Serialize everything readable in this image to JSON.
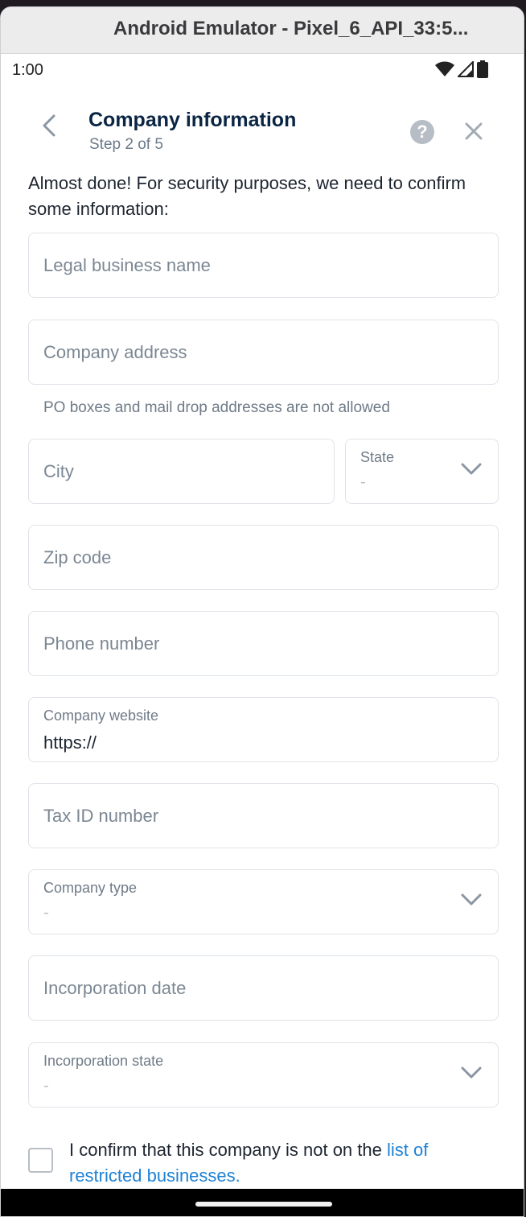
{
  "window": {
    "title": "Android Emulator - Pixel_6_API_33:5..."
  },
  "status_bar": {
    "time": "1:00",
    "icons": [
      "wifi-icon",
      "signal-icon",
      "battery-icon"
    ]
  },
  "header": {
    "title": "Company information",
    "step": "Step 2 of 5",
    "icons": {
      "back": "chevron-left-icon",
      "help": "help-icon",
      "close": "close-icon"
    },
    "help_glyph": "?"
  },
  "intro": "Almost done! For security purposes, we need to confirm some information:",
  "fields": {
    "legal_name": {
      "placeholder": "Legal business name"
    },
    "address": {
      "placeholder": "Company address",
      "hint": "PO boxes and mail drop addresses are not allowed"
    },
    "city": {
      "placeholder": "City"
    },
    "state": {
      "label": "State",
      "value": "-"
    },
    "zip": {
      "placeholder": "Zip code"
    },
    "phone": {
      "placeholder": "Phone number"
    },
    "website": {
      "label": "Company website",
      "value": "https://"
    },
    "tax_id": {
      "placeholder": "Tax ID number"
    },
    "company_type": {
      "label": "Company type",
      "value": "-"
    },
    "incorporation_date": {
      "placeholder": "Incorporation date"
    },
    "incorporation_state": {
      "label": "Incorporation state",
      "value": "-"
    }
  },
  "confirm": {
    "text": "I confirm that this company is not on the ",
    "link": "list of restricted businesses."
  },
  "colors": {
    "accent": "#1d82d6",
    "title": "#0b2544",
    "placeholder": "#7b8793",
    "border": "#dfe3e8"
  }
}
